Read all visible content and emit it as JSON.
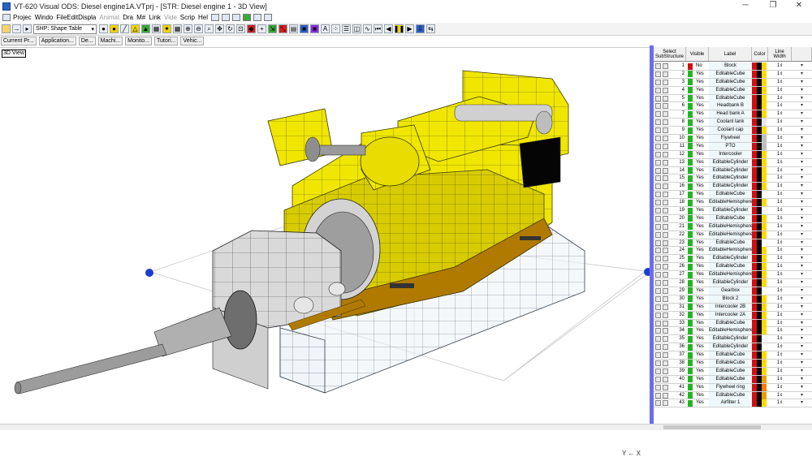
{
  "window": {
    "title": "VT-620 Visual ODS: Diesel engine1A.VTprj - [STR: Diesel engine 1 - 3D View]",
    "controls": {
      "minimize": "─",
      "restore": "❐",
      "close": "✕"
    }
  },
  "menubar": {
    "items": [
      {
        "label": "Projec",
        "disabled": false
      },
      {
        "label": "Windo",
        "disabled": false
      },
      {
        "label": "FileEdit",
        "disabled": false
      },
      {
        "label": "Displa",
        "disabled": false
      },
      {
        "label": "Animat",
        "disabled": true
      },
      {
        "label": "Dra",
        "disabled": false
      },
      {
        "label": "M#",
        "disabled": false
      },
      {
        "label": "Link",
        "disabled": false
      },
      {
        "label": "Vide",
        "disabled": true
      },
      {
        "label": "Scrip",
        "disabled": false
      },
      {
        "label": "Hel",
        "disabled": false
      }
    ]
  },
  "toolbar": {
    "shape_select": "SHP: Shape Table",
    "colors": {
      "accent": "#f1d400",
      "blue": "#2a5fc4",
      "green": "#3aa83a",
      "red": "#d02020"
    }
  },
  "tabs": [
    "Current Pr...",
    "Application...",
    "De...",
    "Machi...",
    "Monito...",
    "Tutori...",
    "Vehic..."
  ],
  "view": {
    "label": "3D View",
    "axes": "Y ← X"
  },
  "table": {
    "headers": [
      "Select SubStructure",
      "Visible",
      "Label",
      "Color",
      "Line Width"
    ],
    "rows": [
      {
        "n": "1",
        "vis": "No",
        "label": "Block",
        "c": [
          "#d01010",
          "#000000",
          "#ffd800"
        ],
        "w": "1"
      },
      {
        "n": "2",
        "vis": "Yes",
        "label": "EditableCube",
        "c": [
          "#d01010",
          "#000000",
          "#ffd800"
        ],
        "w": "1"
      },
      {
        "n": "3",
        "vis": "Yes",
        "label": "EditableCube",
        "c": [
          "#d01010",
          "#000000",
          "#ffd800"
        ],
        "w": "1"
      },
      {
        "n": "4",
        "vis": "Yes",
        "label": "EditableCube",
        "c": [
          "#d01010",
          "#000000",
          "#ffd800"
        ],
        "w": "1"
      },
      {
        "n": "5",
        "vis": "Yes",
        "label": "EditableCube",
        "c": [
          "#d01010",
          "#000000",
          "#ffd800"
        ],
        "w": "1"
      },
      {
        "n": "6",
        "vis": "Yes",
        "label": "Headbank B",
        "c": [
          "#d01010",
          "#000000",
          "#ffd800"
        ],
        "w": "1"
      },
      {
        "n": "7",
        "vis": "Yes",
        "label": "Head bank A",
        "c": [
          "#d01010",
          "#000000",
          "#ffd800"
        ],
        "w": "1"
      },
      {
        "n": "8",
        "vis": "Yes",
        "label": "Coolant tank",
        "c": [
          "#d01010",
          "#000000",
          "#e8e8e8"
        ],
        "w": "1"
      },
      {
        "n": "9",
        "vis": "Yes",
        "label": "Coolant cap",
        "c": [
          "#d01010",
          "#000000",
          "#ffd800"
        ],
        "w": "1"
      },
      {
        "n": "10",
        "vis": "Yes",
        "label": "Flywheel",
        "c": [
          "#d01010",
          "#000000",
          "#bdbdbd"
        ],
        "w": "1"
      },
      {
        "n": "11",
        "vis": "Yes",
        "label": "PTO",
        "c": [
          "#d01010",
          "#000000",
          "#bdbdbd"
        ],
        "w": "1"
      },
      {
        "n": "12",
        "vis": "Yes",
        "label": "Intercooler",
        "c": [
          "#d01010",
          "#000000",
          "#ffd800"
        ],
        "w": "1"
      },
      {
        "n": "13",
        "vis": "Yes",
        "label": "EditableCylinder",
        "c": [
          "#d01010",
          "#000000",
          "#ffd800"
        ],
        "w": "1"
      },
      {
        "n": "14",
        "vis": "Yes",
        "label": "EditableCylinder",
        "c": [
          "#d01010",
          "#000000",
          "#ffd800"
        ],
        "w": "1"
      },
      {
        "n": "15",
        "vis": "Yes",
        "label": "EditableCylinder",
        "c": [
          "#d01010",
          "#000000",
          "#ffd800"
        ],
        "w": "1"
      },
      {
        "n": "16",
        "vis": "Yes",
        "label": "EditableCylinder",
        "c": [
          "#d01010",
          "#000000",
          "#ffd800"
        ],
        "w": "1"
      },
      {
        "n": "17",
        "vis": "Yes",
        "label": "EditableCube",
        "c": [
          "#d01010",
          "#000000",
          "#ffffff"
        ],
        "w": "1"
      },
      {
        "n": "18",
        "vis": "Yes",
        "label": "EditableHemisphere",
        "c": [
          "#d01010",
          "#000000",
          "#ffd800"
        ],
        "w": "1"
      },
      {
        "n": "19",
        "vis": "Yes",
        "label": "EditableCylinder",
        "c": [
          "#d01010",
          "#000000",
          "#ffffff"
        ],
        "w": "1"
      },
      {
        "n": "20",
        "vis": "Yes",
        "label": "EditableCube",
        "c": [
          "#d01010",
          "#000000",
          "#ffd800"
        ],
        "w": "1"
      },
      {
        "n": "21",
        "vis": "Yes",
        "label": "EditableHemisphere",
        "c": [
          "#d01010",
          "#000000",
          "#ffd800"
        ],
        "w": "1"
      },
      {
        "n": "22",
        "vis": "Yes",
        "label": "EditableHemisphere",
        "c": [
          "#d01010",
          "#000000",
          "#ffd800"
        ],
        "w": "1"
      },
      {
        "n": "23",
        "vis": "Yes",
        "label": "EditableCube",
        "c": [
          "#d01010",
          "#000000",
          "#ffffff"
        ],
        "w": "1"
      },
      {
        "n": "24",
        "vis": "Yes",
        "label": "EditableHemisphere",
        "c": [
          "#d01010",
          "#000000",
          "#ffd800"
        ],
        "w": "1"
      },
      {
        "n": "25",
        "vis": "Yes",
        "label": "EditableCylinder",
        "c": [
          "#d01010",
          "#000000",
          "#ffd800"
        ],
        "w": "1"
      },
      {
        "n": "26",
        "vis": "Yes",
        "label": "EditableCube",
        "c": [
          "#d01010",
          "#000000",
          "#ffd800"
        ],
        "w": "1"
      },
      {
        "n": "27",
        "vis": "Yes",
        "label": "EditableHemisphere",
        "c": [
          "#d01010",
          "#000000",
          "#ffd800"
        ],
        "w": "1"
      },
      {
        "n": "28",
        "vis": "Yes",
        "label": "EditableCylinder",
        "c": [
          "#d01010",
          "#000000",
          "#ffd800"
        ],
        "w": "1"
      },
      {
        "n": "29",
        "vis": "Yes",
        "label": "Gearbox",
        "c": [
          "#d01010",
          "#000000",
          "#ffffff"
        ],
        "w": "1"
      },
      {
        "n": "30",
        "vis": "Yes",
        "label": "Block 2",
        "c": [
          "#d01010",
          "#000000",
          "#ffd800"
        ],
        "w": "1"
      },
      {
        "n": "31",
        "vis": "Yes",
        "label": "Intercooler 2B",
        "c": [
          "#d01010",
          "#000000",
          "#ffd800"
        ],
        "w": "1"
      },
      {
        "n": "32",
        "vis": "Yes",
        "label": "Intercooler 2A",
        "c": [
          "#d01010",
          "#000000",
          "#ffd800"
        ],
        "w": "1"
      },
      {
        "n": "33",
        "vis": "Yes",
        "label": "EditableCube",
        "c": [
          "#d01010",
          "#000000",
          "#ffd800"
        ],
        "w": "1"
      },
      {
        "n": "34",
        "vis": "Yes",
        "label": "EditableHemisphere",
        "c": [
          "#d01010",
          "#000000",
          "#ffd800"
        ],
        "w": "1"
      },
      {
        "n": "35",
        "vis": "Yes",
        "label": "EditableCylinder",
        "c": [
          "#d01010",
          "#000000",
          "#ffffff"
        ],
        "w": "1"
      },
      {
        "n": "36",
        "vis": "Yes",
        "label": "EditableCylinder",
        "c": [
          "#d01010",
          "#000000",
          "#ffffff"
        ],
        "w": "1"
      },
      {
        "n": "37",
        "vis": "Yes",
        "label": "EditableCube",
        "c": [
          "#d01010",
          "#000000",
          "#ffd800"
        ],
        "w": "1"
      },
      {
        "n": "38",
        "vis": "Yes",
        "label": "EditableCube",
        "c": [
          "#d01010",
          "#000000",
          "#ffd800"
        ],
        "w": "1"
      },
      {
        "n": "39",
        "vis": "Yes",
        "label": "EditableCube",
        "c": [
          "#d01010",
          "#000000",
          "#ffd800"
        ],
        "w": "1"
      },
      {
        "n": "40",
        "vis": "Yes",
        "label": "EditableCube",
        "c": [
          "#d01010",
          "#000000",
          "#e8a000"
        ],
        "w": "1"
      },
      {
        "n": "41",
        "vis": "Yes",
        "label": "Flywheel ring",
        "c": [
          "#d01010",
          "#000000",
          "#ff7a00"
        ],
        "w": "1"
      },
      {
        "n": "42",
        "vis": "Yes",
        "label": "EditableCube",
        "c": [
          "#d01010",
          "#000000",
          "#e8a000"
        ],
        "w": "1"
      },
      {
        "n": "43",
        "vis": "Yes",
        "label": "Airfilter 1",
        "c": [
          "#d01010",
          "#000000",
          "#ffd800"
        ],
        "w": "1"
      }
    ]
  }
}
